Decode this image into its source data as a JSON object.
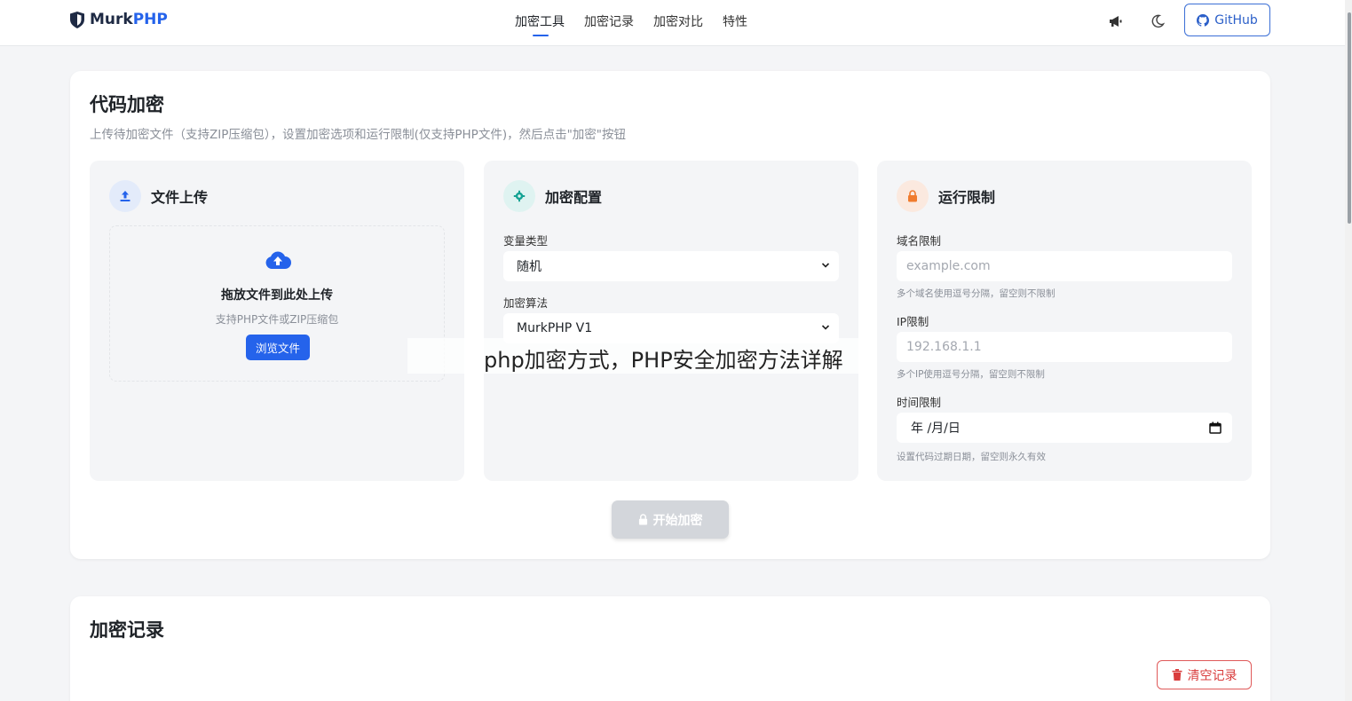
{
  "brand": {
    "part1": "Murk",
    "part2": "PHP",
    "icon": "shield-icon",
    "accent": "#2563eb"
  },
  "nav": {
    "links": [
      "加密工具",
      "加密记录",
      "加密对比",
      "特性"
    ],
    "active_index": 0,
    "github_label": "GitHub",
    "icons": [
      "megaphone-icon",
      "moon-icon",
      "github-icon"
    ]
  },
  "encrypt": {
    "title": "代码加密",
    "subtitle": "上传待加密文件（支持ZIP压缩包），设置加密选项和运行限制(仅支持PHP文件)，然后点击\"加密\"按钮",
    "upload": {
      "title": "文件上传",
      "drop_title": "拖放文件到此处上传",
      "drop_sub": "支持PHP文件或ZIP压缩包",
      "browse_label": "浏览文件"
    },
    "config": {
      "title": "加密配置",
      "var_type_label": "变量类型",
      "var_type_value": "随机",
      "algo_label": "加密算法",
      "algo_value": "MurkPHP V1"
    },
    "limits": {
      "title": "运行限制",
      "domain_label": "域名限制",
      "domain_placeholder": "example.com",
      "domain_hint": "多个域名使用逗号分隔，留空则不限制",
      "ip_label": "IP限制",
      "ip_placeholder": "192.168.1.1",
      "ip_hint": "多个IP使用逗号分隔，留空则不限制",
      "time_label": "时间限制",
      "time_placeholder": "年 /月/日",
      "time_hint": "设置代码过期日期，留空则永久有效"
    },
    "start_label": "开始加密"
  },
  "watermark": "php加密方式，PHP安全加密方法详解",
  "records": {
    "title": "加密记录",
    "clear_label": "清空记录"
  }
}
